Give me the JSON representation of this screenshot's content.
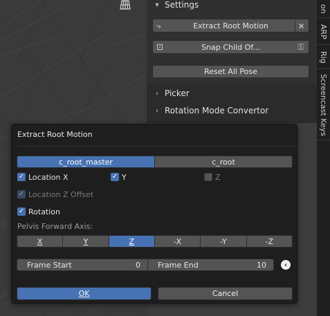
{
  "viewport": {
    "ortho_icon": "grid-ortho-icon"
  },
  "npanel": {
    "settings_header": "Settings",
    "extract_button": "Extract Root Motion",
    "snap_button": "Snap Child Of...",
    "reset_button": "Reset All Pose",
    "picker_header": "Picker",
    "rotation_header": "Rotation Mode Convertor"
  },
  "tabs": [
    "on",
    "ARP",
    "Rig",
    "Screencast Keys"
  ],
  "dialog": {
    "title": "Extract Root Motion",
    "source_options": [
      "c_root_master",
      "c_root"
    ],
    "source_selected": "c_root_master",
    "location_x_label": "Location X",
    "location_y_label": "Y",
    "location_z_label": "Z",
    "location_x": true,
    "location_y": true,
    "location_z": false,
    "location_z_offset_label": "Location Z Offset",
    "location_z_offset": true,
    "rotation_label": "Rotation",
    "rotation": true,
    "pelvis_label": "Pelvis Forward Axis:",
    "axes": [
      "X",
      "Y",
      "Z",
      "-X",
      "-Y",
      "-Z"
    ],
    "axis_selected": "Z",
    "frame_start_label": "Frame Start",
    "frame_start": "0",
    "frame_end_label": "Frame End",
    "frame_end": "10",
    "ok_label": "OK",
    "cancel_label": "Cancel"
  },
  "colors": {
    "accent": "#4772b3",
    "button": "#545454",
    "dialog_bg": "#1e1e1e"
  }
}
